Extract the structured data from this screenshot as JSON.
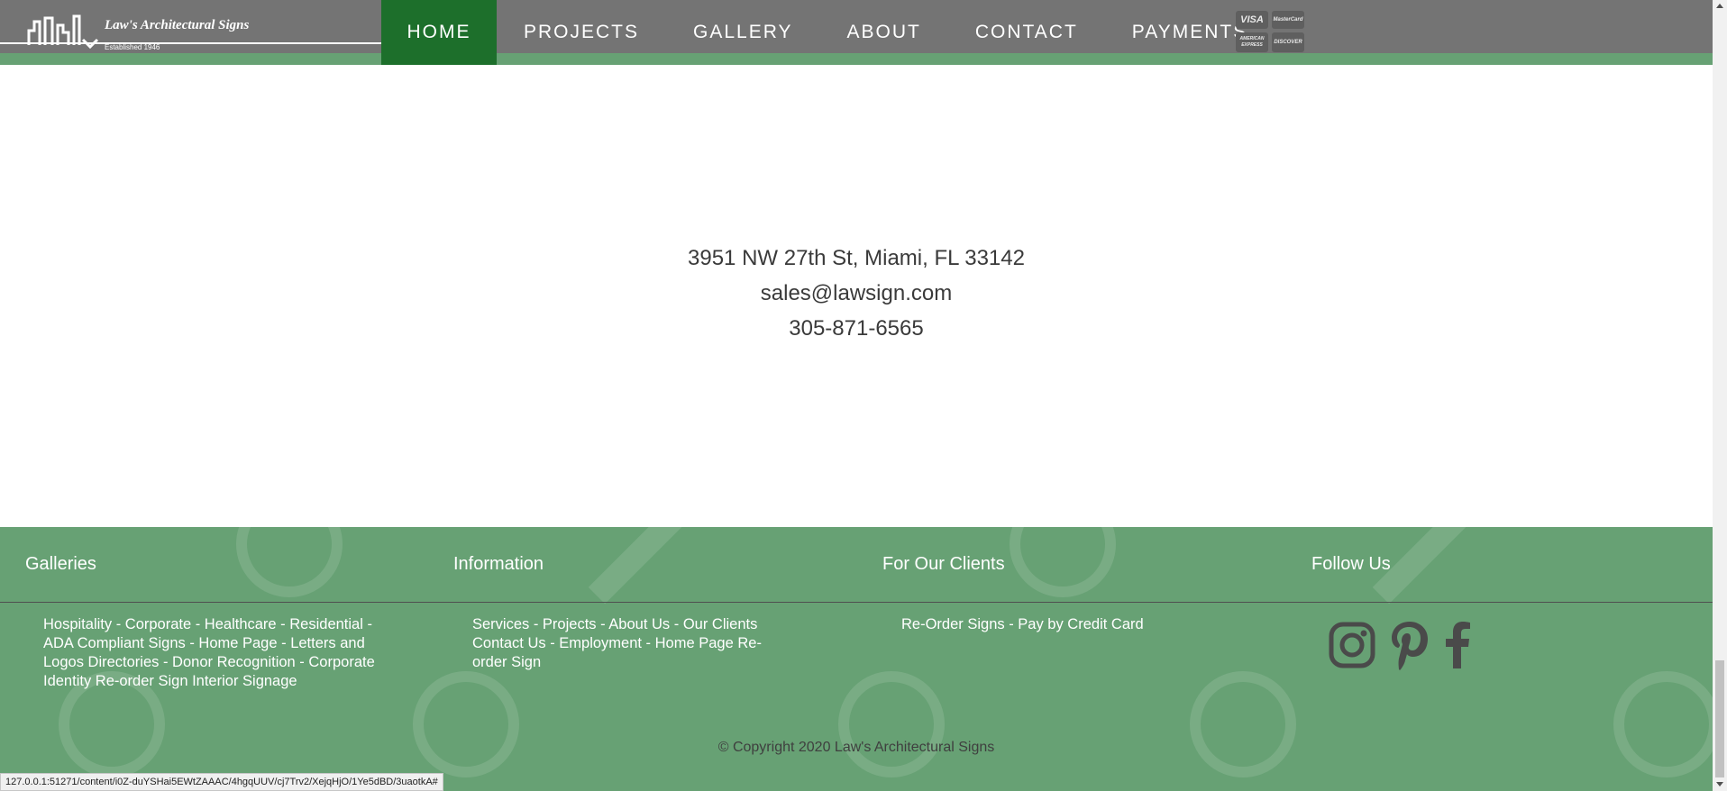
{
  "logo": {
    "title": "Law's Architectural Signs",
    "subtitle": "Established 1946"
  },
  "nav": {
    "items": [
      {
        "label": "HOME"
      },
      {
        "label": "PROJECTS"
      },
      {
        "label": "GALLERY"
      },
      {
        "label": "ABOUT"
      },
      {
        "label": "CONTACT"
      },
      {
        "label": "PAYMENTS"
      }
    ],
    "cards": [
      "VISA",
      "MasterCard",
      "AMERICAN EXPRESS",
      "DISCOVER"
    ]
  },
  "contact": {
    "address": "3951 NW 27th St, Miami, FL 33142",
    "email": "sales@lawsign.com",
    "phone": "305-871-6565"
  },
  "footer": {
    "columns": [
      {
        "title": "Galleries",
        "links": "Hospitality - Corporate - Healthcare - Residential - ADA Compliant Signs - Home Page - Letters and Logos Directories - Donor Recognition - Corporate Identity Re-order Sign Interior Signage"
      },
      {
        "title": "Information",
        "links": "Services - Projects - About Us - Our Clients Contact Us - Employment - Home Page Re-order Sign"
      },
      {
        "title": "For Our Clients",
        "links": "Re-Order Signs - Pay by Credit Card"
      },
      {
        "title": "Follow Us"
      }
    ],
    "social": [
      "instagram-icon",
      "pinterest-icon",
      "facebook-icon"
    ],
    "copyright": "© Copyright 2020 Law's Architectural Signs"
  },
  "statusbar": {
    "url": "127.0.0.1:51271/content/i0Z-duYSHai5EWtZAAAC/4hgqUUV/cj7Trv2/XejqHjO/1Ye5dBD/3uaotkA#"
  },
  "colors": {
    "header": "#747474",
    "active_nav": "#1d6f2b",
    "footer": "#67a174",
    "accent_strip": "#67a174"
  }
}
